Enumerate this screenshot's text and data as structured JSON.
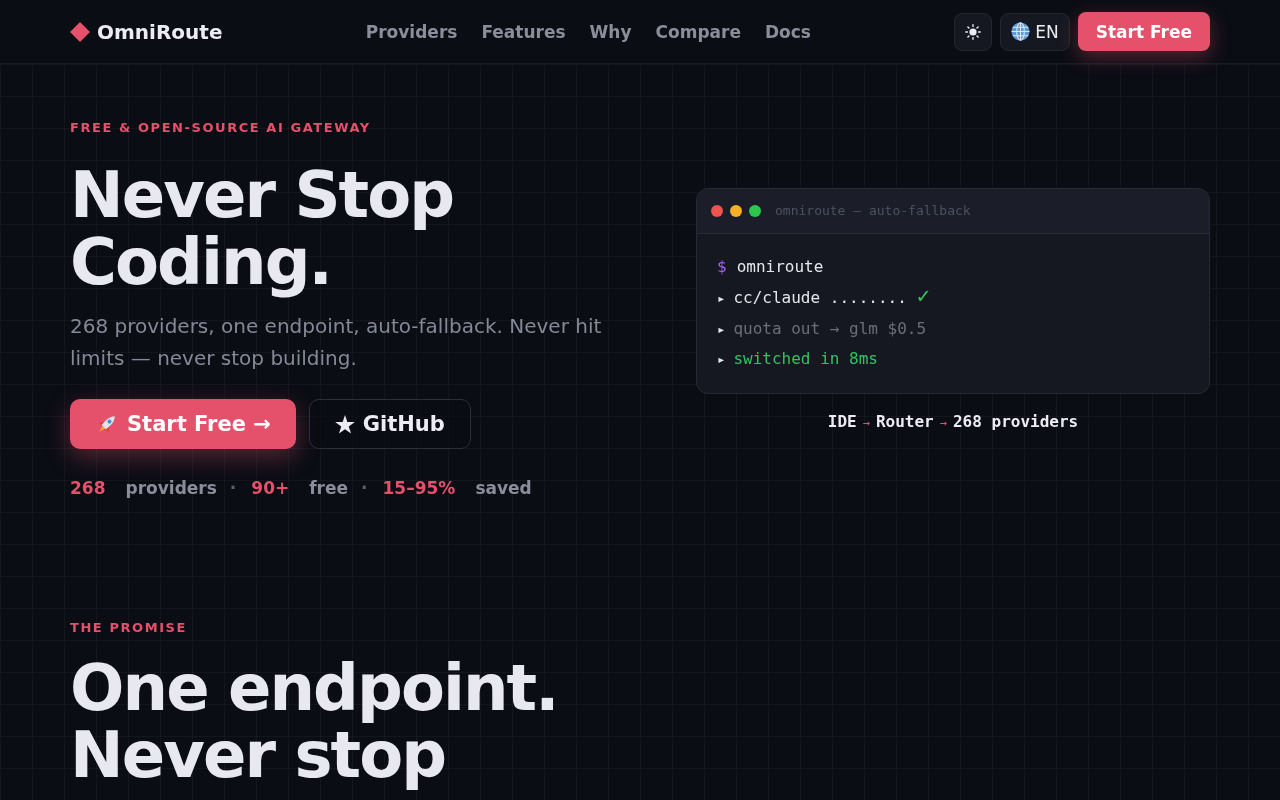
{
  "header": {
    "brand": "OmniRoute",
    "nav": [
      "Providers",
      "Features",
      "Why",
      "Compare",
      "Docs"
    ],
    "language": "EN",
    "cta": "Start Free"
  },
  "hero": {
    "eyebrow": "FREE & OPEN-SOURCE AI GATEWAY",
    "title": "Never Stop Coding.",
    "subtitle": "268 providers, one endpoint, auto-fallback. Never hit limits — never stop building.",
    "buttons": [
      {
        "kind": "primary",
        "label": "Start Free →"
      },
      {
        "kind": "secondary",
        "label": "GitHub"
      }
    ],
    "stats": {
      "separator": "·",
      "items": [
        {
          "value": "268",
          "label": "providers"
        },
        {
          "value": "90+",
          "label": "free"
        },
        {
          "value": "15–95%",
          "label": "saved"
        }
      ]
    }
  },
  "terminal": {
    "title": "omniroute — auto-fallback",
    "lines": [
      {
        "kind": "command",
        "prompt": "$",
        "text": "omniroute"
      },
      {
        "kind": "ok",
        "marker": "▸",
        "text": "cc/claude ........",
        "status": "✓"
      },
      {
        "kind": "muted",
        "marker": "▸",
        "text": "quota out → glm $0.5"
      },
      {
        "kind": "success",
        "marker": "▸",
        "text": "switched in 8ms"
      }
    ]
  },
  "flow": {
    "arrow": "→",
    "steps": [
      "IDE",
      "Router",
      "268 providers"
    ]
  },
  "promise": {
    "eyebrow": "THE PROMISE",
    "title": "One endpoint. Never stop"
  }
}
